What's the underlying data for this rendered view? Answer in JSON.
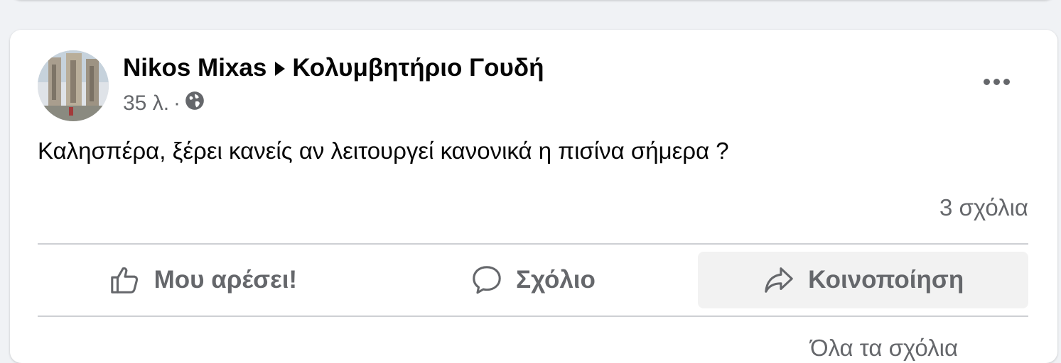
{
  "post": {
    "author": "Nikos Mixas",
    "group": "Κολυμβητήριο Γουδή",
    "time": "35 λ.",
    "dot": "·",
    "text": "Καλησπέρα, ξέρει κανείς αν λειτουργεί κανονικά η πισίνα σήμερα ?",
    "comment_count": "3 σχόλια",
    "more_cutoff": "Όλα τα σχόλια"
  },
  "actions": {
    "like_label": "Μου αρέσει!",
    "comment_label": "Σχόλιο",
    "share_label": "Κοινοποίηση"
  },
  "icons": {
    "privacy": "globe-icon",
    "like": "thumbs-up-icon",
    "comment": "speech-bubble-icon",
    "share": "share-arrow-icon",
    "more": "more-dots-icon"
  },
  "colors": {
    "text_primary": "#050505",
    "text_secondary": "#65676b",
    "background": "#f0f2f5",
    "card": "#ffffff",
    "divider": "#ced0d4",
    "hover": "#f2f2f2"
  }
}
